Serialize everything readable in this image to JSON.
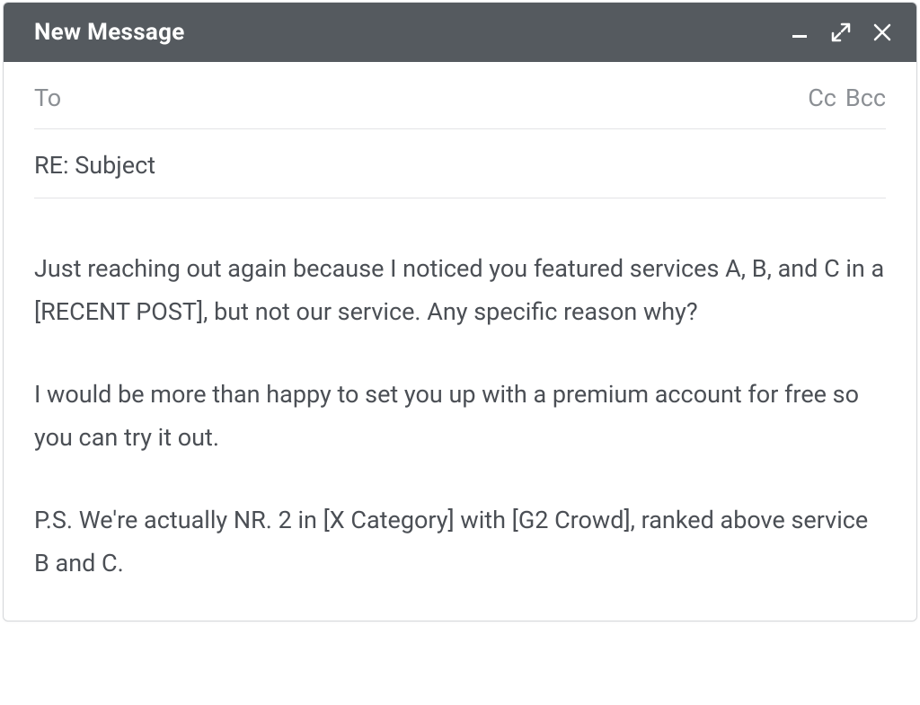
{
  "titlebar": {
    "title": "New Message"
  },
  "fields": {
    "to_label": "To",
    "cc_label": "Cc",
    "bcc_label": "Bcc",
    "subject": "RE: Subject"
  },
  "body": {
    "p1": "Just reaching out again because I noticed you featured services A, B, and C in a [RECENT POST], but not our service. Any specific reason why?",
    "p2": "I would be more than happy to set you up with a premium account for free so you can try it out.",
    "p3": "P.S. We're actually NR. 2 in [X Category] with [G2 Crowd], ranked above service B and C."
  }
}
